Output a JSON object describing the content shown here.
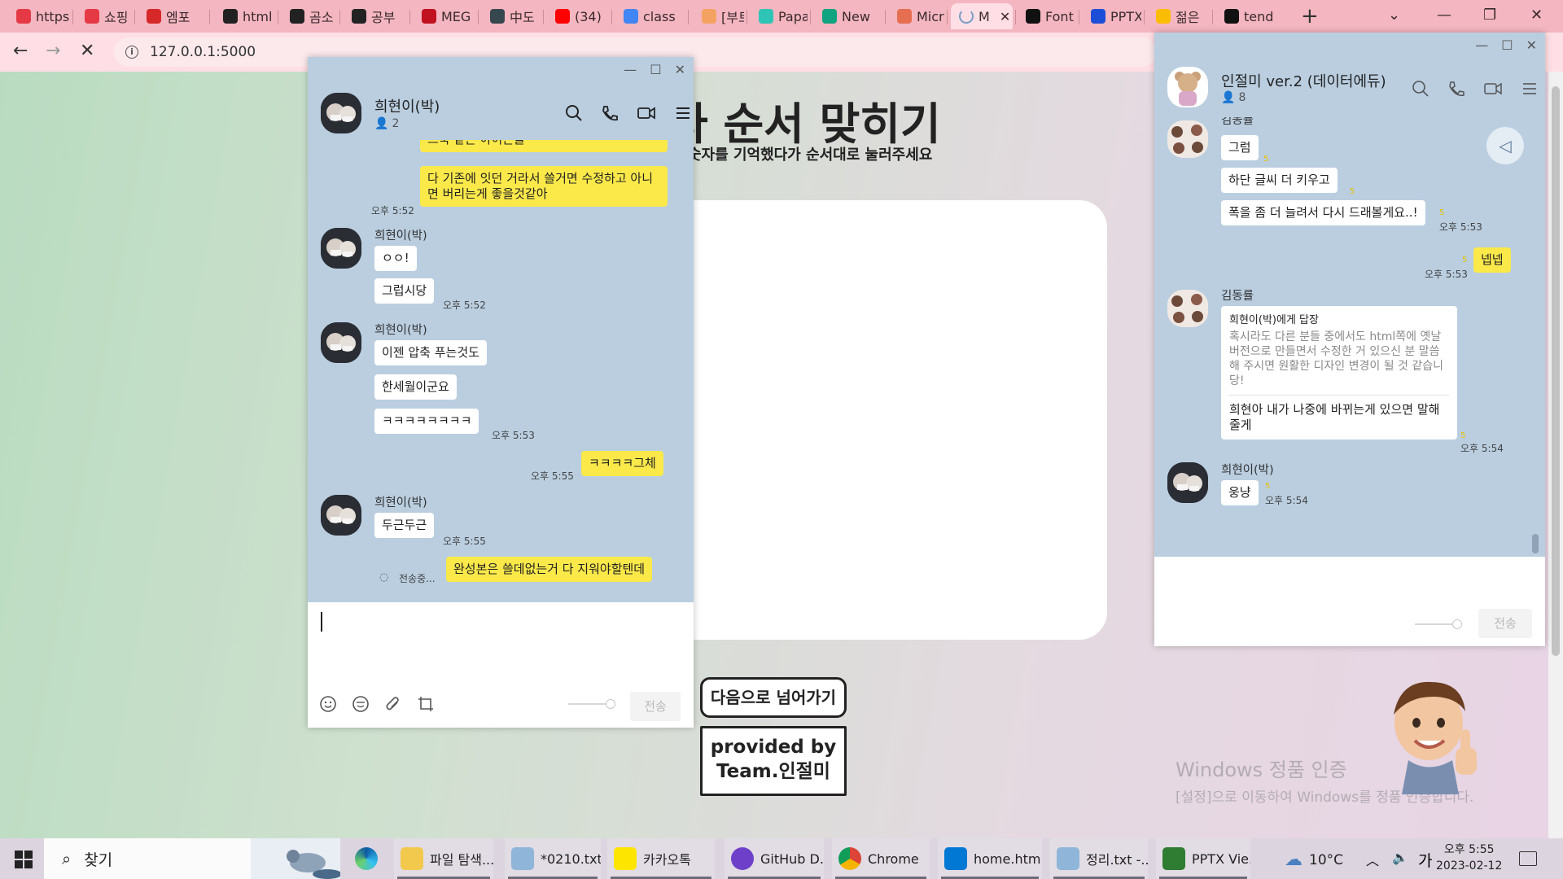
{
  "browser": {
    "tabs": [
      {
        "label": "https",
        "icon": "pocket-icon",
        "color": "#e63946"
      },
      {
        "label": "쇼핑",
        "icon": "pocket-icon",
        "color": "#e63946"
      },
      {
        "label": "엠포",
        "icon": "m-logo-icon",
        "color": "#d62828"
      },
      {
        "label": "html",
        "icon": "dots-icon",
        "color": "#222222"
      },
      {
        "label": "곰소",
        "icon": "dots-icon",
        "color": "#222222"
      },
      {
        "label": "공부",
        "icon": "dots-icon",
        "color": "#222222"
      },
      {
        "label": "MEG",
        "icon": "meg-icon",
        "color": "#c1121f"
      },
      {
        "label": "中도",
        "icon": "t-icon",
        "color": "#37474f"
      },
      {
        "label": "(34)",
        "icon": "youtube-icon",
        "color": "#ff0000"
      },
      {
        "label": "class",
        "icon": "google-icon",
        "color": "#4285f4"
      },
      {
        "label": "[부트",
        "icon": "note-icon",
        "color": "#f4a261"
      },
      {
        "label": "Papa",
        "icon": "papago-icon",
        "color": "#2ec4b6"
      },
      {
        "label": "New",
        "icon": "openai-icon",
        "color": "#10a37f"
      },
      {
        "label": "Micr",
        "icon": "shield-icon",
        "color": "#e76f51"
      },
      {
        "label": "M",
        "icon": "loading-icon",
        "color": "#7a9cc6"
      },
      {
        "label": "Font",
        "icon": "flag-icon",
        "color": "#111111"
      },
      {
        "label": "PPTX",
        "icon": "pptx-icon",
        "color": "#1d4ed8"
      },
      {
        "label": "젊은",
        "icon": "drive-icon",
        "color": "#fbbc04"
      },
      {
        "label": "tend",
        "icon": "github-icon",
        "color": "#111111"
      }
    ],
    "new_tab": "+",
    "url": "127.0.0.1:5000"
  },
  "page": {
    "title": "다 순서 맞히기",
    "subtitle": "숫자를 기억했다가 순서대로 눌러주세요",
    "next_button": "다음으로 넘어가기",
    "credit_line1": "provided by",
    "credit_line2": "Team.인절미",
    "activation_title": "Windows 정품 인증",
    "activation_text": "[설정]으로 이동하여 Windows를 정품 인증합니다."
  },
  "chat_left": {
    "name": "희현이(박)",
    "members": "2",
    "partial_bubble": "스북 같은 아이콘을",
    "messages": [
      {
        "text": "다 기존에 잇던 거라서 쓸거면 수정하고 아니면 버리는게 좋을것같아",
        "time": "오후 5:52"
      },
      {
        "sender": "희현이(박)",
        "text": "ㅇㅇ!"
      },
      {
        "text": "그럽시당",
        "time": "오후 5:52"
      },
      {
        "sender": "희현이(박)",
        "text": "이젠 압축 푸는것도"
      },
      {
        "text": "한세월이군요"
      },
      {
        "text": "ㅋㅋㅋㅋㅋㅋㅋㅋ",
        "time": "오후 5:53"
      },
      {
        "text": "ㅋㅋㅋㅋ그체",
        "time": "오후 5:55"
      },
      {
        "sender": "희현이(박)",
        "text": "두근두근",
        "time": "오후 5:55"
      },
      {
        "text": "완성본은 쓸데없는거 다 지워야할텐데",
        "status": "전송중..."
      }
    ],
    "send_label": "전송"
  },
  "chat_right": {
    "name": "인절미 ver.2 (데이터에듀)",
    "members": "8",
    "partial_sender": "김동률",
    "unread_marker": "5",
    "messages": [
      {
        "text": "그럼",
        "unread": "5"
      },
      {
        "text": "하단 글씨 더 키우고",
        "unread": "5"
      },
      {
        "text": "폭을 좀 더 늘려서 다시 드래볼게요..!",
        "unread": "5",
        "time": "오후 5:53"
      },
      {
        "text": "넵넵",
        "unread": "5",
        "time": "오후 5:53"
      },
      {
        "sender": "김동률",
        "reply_to": "희현이(박)에게 답장",
        "quoted": "혹시라도 다른 분들 중에서도 html쪽에 옛날 버전으로 만들면서 수정한 거 있으신 분 말씀해 주시면 원활한 디자인 변경이 될 것 같습니당!",
        "text": "희현아 내가 나중에 바뀌는게 있으면 말해줄게",
        "unread": "5",
        "time": "오후 5:54"
      },
      {
        "sender": "희현이(박)",
        "text": "웅냥",
        "unread": "5",
        "time": "오후 5:54"
      }
    ],
    "send_label": "전송"
  },
  "taskbar": {
    "search_label": "찾기",
    "items": [
      {
        "label": "파일 탐색...",
        "icon": "folder-icon",
        "color": "#f2c94c"
      },
      {
        "label": "*0210.txt -...",
        "icon": "notepad-icon",
        "color": "#8fb6d8"
      },
      {
        "label": "카카오톡",
        "icon": "kakaotalk-icon",
        "color": "#fee500"
      },
      {
        "label": "GitHub D...",
        "icon": "github-desktop-icon",
        "color": "#6e40c9"
      },
      {
        "label": "Chrome",
        "icon": "chrome-icon",
        "color": "#4285f4"
      },
      {
        "label": "home.htm...",
        "icon": "vscode-icon",
        "color": "#0078d4"
      },
      {
        "label": "정리.txt -...",
        "icon": "notepad-icon",
        "color": "#8fb6d8"
      },
      {
        "label": "PPTX Vie...",
        "icon": "pptx-viewer-icon",
        "color": "#2e7d32"
      }
    ],
    "weather": "10°C",
    "ime": "가",
    "time": "오후 5:55",
    "date": "2023-02-12"
  }
}
